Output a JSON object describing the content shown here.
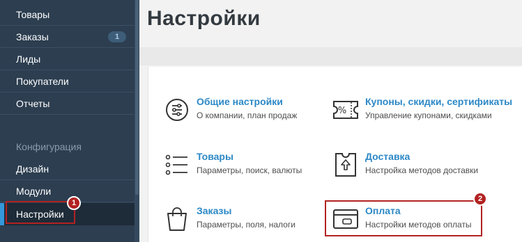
{
  "sidebar": {
    "items": [
      {
        "label": "Товары"
      },
      {
        "label": "Заказы",
        "badge": "1"
      },
      {
        "label": "Лиды"
      },
      {
        "label": "Покупатели"
      },
      {
        "label": "Отчеты"
      }
    ],
    "section_title": "Конфигурация",
    "config_items": [
      {
        "label": "Дизайн"
      },
      {
        "label": "Модули"
      },
      {
        "label": "Настройки",
        "active": true
      }
    ]
  },
  "main": {
    "page_title": "Настройки",
    "settings": [
      {
        "title": "Общие настройки",
        "desc": "О компании, план продаж",
        "icon": "sliders-icon"
      },
      {
        "title": "Купоны, скидки, сертификаты",
        "desc": "Управление купонами, скидками",
        "icon": "coupon-icon"
      },
      {
        "title": "Товары",
        "desc": "Параметры, поиск, валюты",
        "icon": "list-icon"
      },
      {
        "title": "Доставка",
        "desc": "Настройка методов доставки",
        "icon": "delivery-box-icon"
      },
      {
        "title": "Заказы",
        "desc": "Параметры, поля, налоги",
        "icon": "shopping-bag-icon"
      },
      {
        "title": "Оплата",
        "desc": "Настройки методов оплаты",
        "icon": "credit-card-icon"
      }
    ]
  },
  "annotations": {
    "marker_1": "1",
    "marker_2": "2",
    "color": "#b22222"
  },
  "colors": {
    "sidebar_bg": "#2c3e50",
    "link_blue": "#2c88c6",
    "accent": "#3498db"
  }
}
